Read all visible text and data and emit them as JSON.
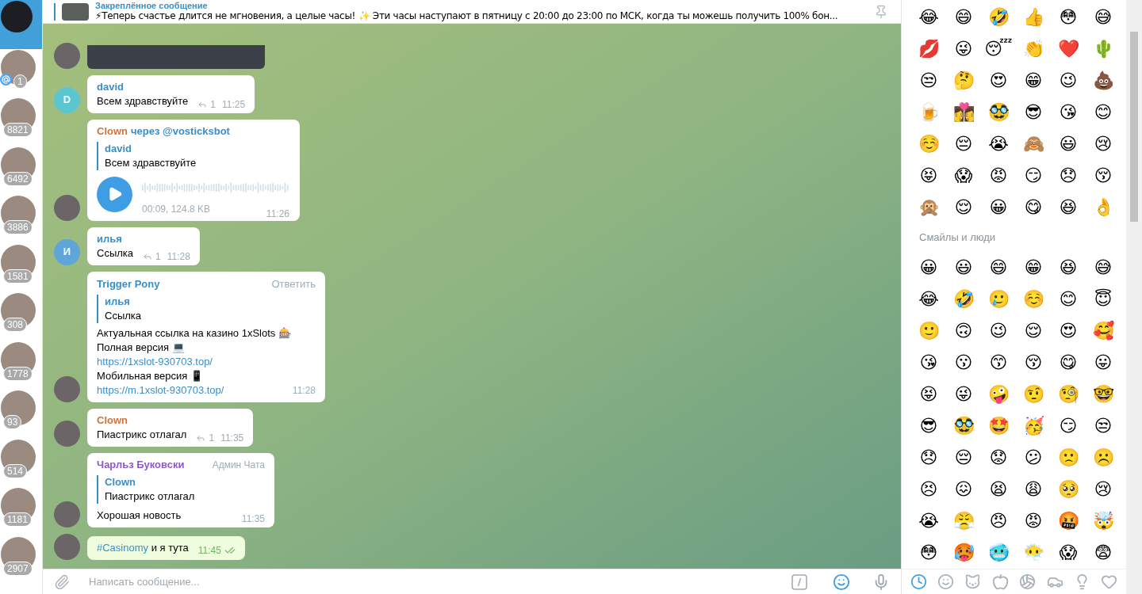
{
  "sidebar": {
    "chats": [
      {
        "selected": true,
        "mention": false
      },
      {
        "count": "1",
        "selected": false,
        "mention": true
      },
      {
        "count": "8821",
        "selected": false,
        "mention": false
      },
      {
        "count": "6492",
        "selected": false,
        "mention": false
      },
      {
        "count": "3886",
        "selected": false,
        "mention": false
      },
      {
        "count": "1581",
        "selected": false,
        "mention": false
      },
      {
        "count": "308",
        "selected": false,
        "mention": false
      },
      {
        "count": "1778",
        "selected": false,
        "mention": false
      },
      {
        "count": "93",
        "selected": false,
        "mention": false
      },
      {
        "count": "514",
        "selected": false,
        "mention": false
      },
      {
        "count": "1181",
        "selected": false,
        "mention": false
      },
      {
        "count": "2907",
        "selected": false,
        "mention": false
      }
    ]
  },
  "pinned": {
    "title": "Закреплённое сообщение",
    "text": "⚡Теперь счастье длится не мгновения, а целые часы! ✨ Эти часы наступают в пятницу с 20:00 до 23:00 по МСК, когда ты можешь получить 100% бон..."
  },
  "messages": [
    {
      "kind": "photo"
    },
    {
      "kind": "text",
      "avatar": {
        "letter": "D",
        "color": "#5cc6d0"
      },
      "sender": "david",
      "color": "#3a8fc9",
      "text": "Всем здравствуйте",
      "replies": "1",
      "time": "11:25"
    },
    {
      "kind": "voice",
      "sender": "Clown",
      "via": "через @vosticksbot",
      "color": "#d0733b",
      "quote": {
        "sender": "david",
        "text": "Всем здравствуйте"
      },
      "duration": "00:09, 124.8 KB",
      "time": "11:26"
    },
    {
      "kind": "text",
      "avatar": {
        "letter": "И",
        "color": "#5ea6d8"
      },
      "sender": "илья",
      "color": "#3a8fc9",
      "text": "Ссылка",
      "replies": "1",
      "time": "11:28"
    },
    {
      "kind": "lines",
      "sender": "Trigger Pony",
      "color": "#3a8fc9",
      "action": "Ответить",
      "quote": {
        "sender": "илья",
        "text": "Ссылка"
      },
      "lines": [
        {
          "kind": "text",
          "text": "Актуальная ссылка на казино 1xSlots 🎰"
        },
        {
          "kind": "text",
          "text": "Полная версия 💻"
        },
        {
          "kind": "link",
          "text": "https://1xslot-930703.top/"
        },
        {
          "kind": "text",
          "text": "Мобильная версия 📱"
        },
        {
          "kind": "link",
          "text": "https://m.1xslot-930703.top/"
        }
      ],
      "time": "11:28"
    },
    {
      "kind": "text",
      "sender": "Clown",
      "color": "#d0733b",
      "text": "Пиастрикс отлагал",
      "replies": "1",
      "time": "11:35"
    },
    {
      "kind": "quoted",
      "sender": "Чарльз Буковски",
      "color": "#8e5ac6",
      "badge": "Админ Чата",
      "quote": {
        "sender": "Clown",
        "text": "Пиастрикс отлагал"
      },
      "text": "Хорошая новость",
      "time": "11:35"
    },
    {
      "kind": "own",
      "hashtag": "#Casinomy",
      "text": "и я тута",
      "time": "11:45",
      "read": true
    }
  ],
  "composer": {
    "placeholder": "Написать сообщение..."
  },
  "emoji_panel": {
    "recent": [
      "😂",
      "😄",
      "🤣",
      "👍",
      "😳",
      "😅",
      "💋",
      "😜",
      "😴",
      "👏",
      "❤️",
      "🌵",
      "😒",
      "🤔",
      "😍",
      "😁",
      "😉",
      "💩",
      "🍺",
      "👩‍❤️‍💋‍👩",
      "🥸",
      "😎",
      "😘",
      "😊",
      "☺️",
      "😔",
      "😭",
      "🙈",
      "😃",
      "😢",
      "😝",
      "😱",
      "😡",
      "😏",
      "😞",
      "😚",
      "🙊",
      "😌",
      "😀",
      "😋",
      "😆",
      "👌"
    ],
    "section_title": "Смайлы и люди",
    "smileys": [
      "😀",
      "😃",
      "😄",
      "😁",
      "😆",
      "😅",
      "😂",
      "🤣",
      "🥲",
      "☺️",
      "😊",
      "😇",
      "🙂",
      "🙃",
      "😉",
      "😌",
      "😍",
      "🥰",
      "😘",
      "😗",
      "😙",
      "😚",
      "😋",
      "😛",
      "😝",
      "😜",
      "🤪",
      "🤨",
      "🧐",
      "🤓",
      "😎",
      "🥸",
      "🤩",
      "🥳",
      "😏",
      "😒",
      "😞",
      "😔",
      "😟",
      "😕",
      "🙁",
      "☹️",
      "😣",
      "😖",
      "😫",
      "😩",
      "🥺",
      "😢",
      "😭",
      "😤",
      "😠",
      "😡",
      "🤬",
      "🤯",
      "😳",
      "🥵",
      "🥶",
      "😶‍🌫️",
      "😱",
      "😨"
    ],
    "tabs": [
      {
        "kind": "recent",
        "selected": true
      },
      {
        "kind": "smileys",
        "selected": false
      },
      {
        "kind": "animals",
        "selected": false
      },
      {
        "kind": "food",
        "selected": false
      },
      {
        "kind": "sport",
        "selected": false
      },
      {
        "kind": "travel",
        "selected": false
      },
      {
        "kind": "objects",
        "selected": false
      },
      {
        "kind": "symbols",
        "selected": false
      }
    ]
  }
}
